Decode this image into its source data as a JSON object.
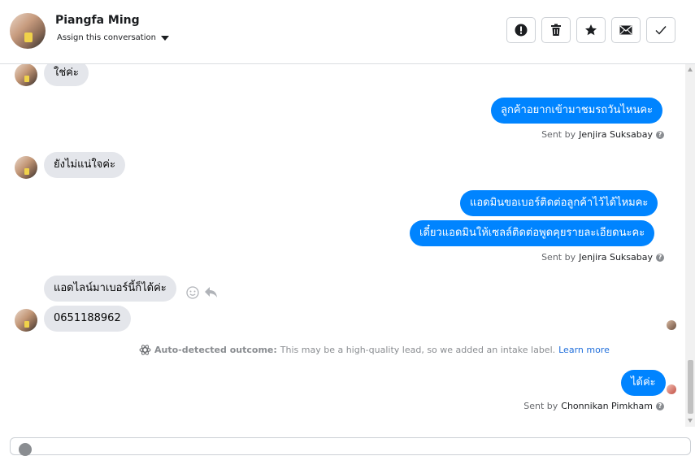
{
  "header": {
    "contact_name": "Piangfa Ming",
    "assign_label": "Assign this conversation",
    "actions": [
      {
        "name": "mark-spam-button",
        "icon": "exclamation-icon"
      },
      {
        "name": "delete-button",
        "icon": "trash-icon"
      },
      {
        "name": "star-button",
        "icon": "star-icon"
      },
      {
        "name": "mark-unread-button",
        "icon": "envelope-icon"
      },
      {
        "name": "mark-done-button",
        "icon": "checkmark-icon"
      }
    ]
  },
  "messages": {
    "m1": "ใช่ค่ะ",
    "m2": "ลูกค้าอยากเข้ามาชมรถวันไหนคะ",
    "m2_sent_prefix": "Sent by",
    "m2_sender": "Jenjira Suksabay",
    "m3": "ยังไม่แน่ใจค่ะ",
    "m4": "แอดมินขอเบอร์ติดต่อลูกค้าไว้ได้ไหมคะ",
    "m5": "เดี๋ยวแอดมินให้เซลล์ติดต่อพูดคุยรายละเอียดนะคะ",
    "m5_sent_prefix": "Sent by",
    "m5_sender": "Jenjira Suksabay",
    "m6": "แอดไลน์มาเบอร์นี้ก็ได้ค่ะ",
    "m7": "0651188962",
    "m8": "ได้ค่ะ",
    "m8_sent_prefix": "Sent by",
    "m8_sender": "Chonnikan Pimkham"
  },
  "outcome": {
    "label": "Auto-detected outcome:",
    "text": "This may be a high-quality lead, so we added an intake label.",
    "link": "Learn more"
  },
  "colors": {
    "outgoing_bubble": "#0084ff",
    "incoming_bubble": "#e4e6eb",
    "link": "#216fdb"
  }
}
